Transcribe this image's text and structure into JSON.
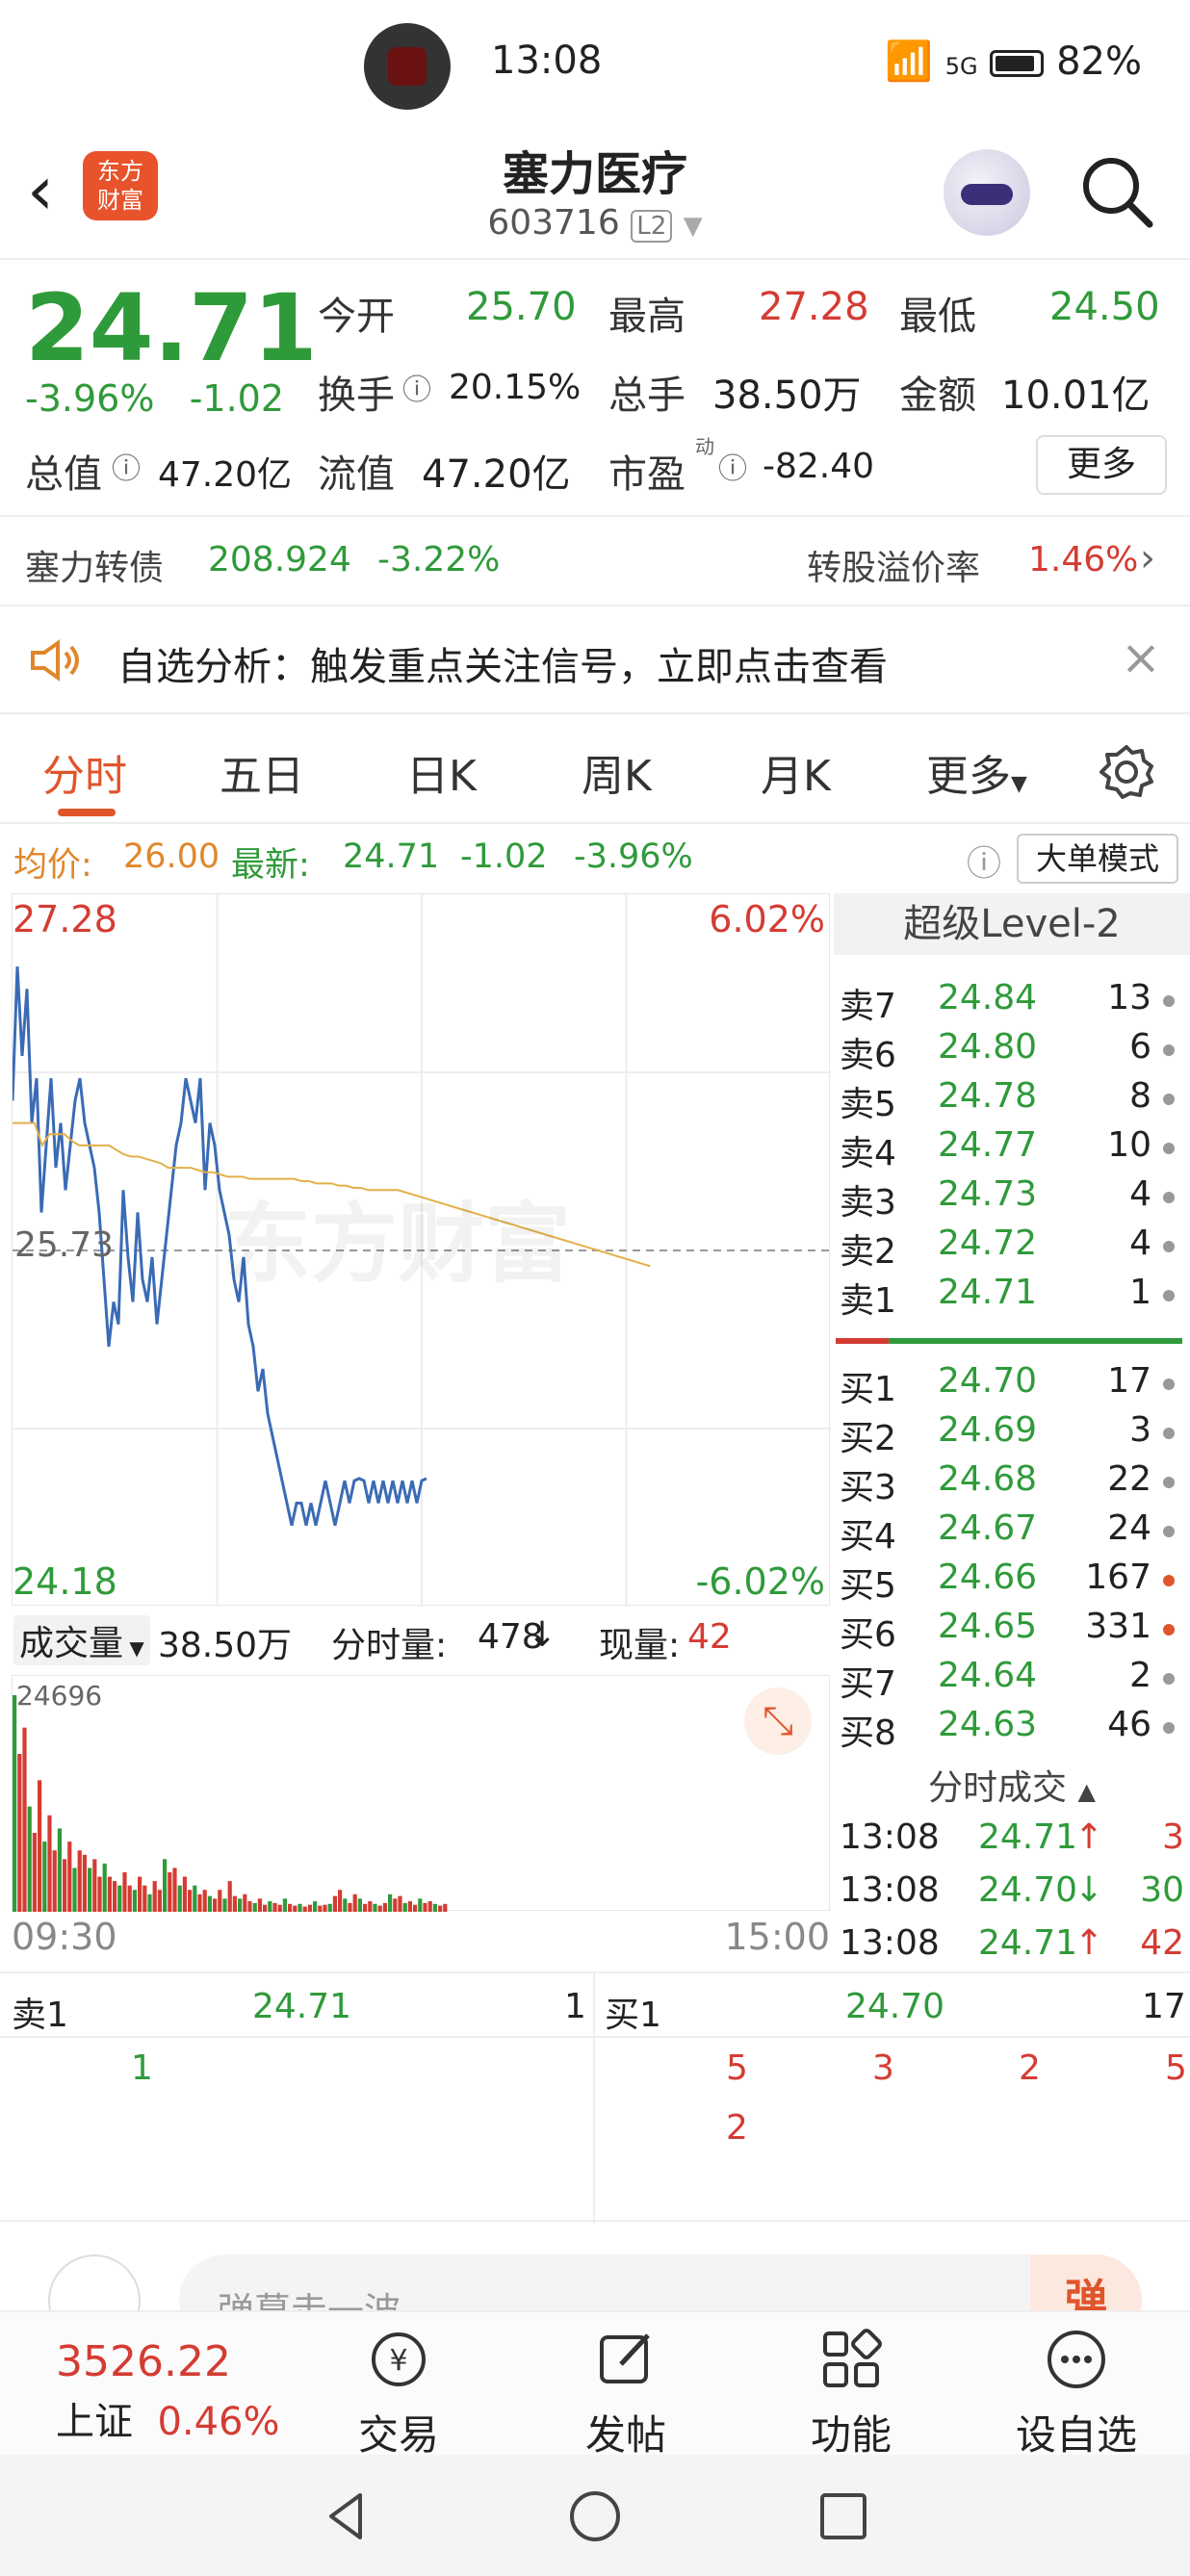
{
  "status_bar": {
    "time": "13:08",
    "network": "5G",
    "battery": "82%"
  },
  "header": {
    "logo_text": "东方财富",
    "title": "塞力医疗",
    "code": "603716",
    "level_badge": "L2"
  },
  "quote": {
    "price": "24.71",
    "change_pct": "-3.96%",
    "change": "-1.02",
    "open_label": "今开",
    "open": "25.70",
    "high_label": "最高",
    "high": "27.28",
    "low_label": "最低",
    "low": "24.50",
    "turnover_label": "换手",
    "turnover": "20.15%",
    "volume_label": "总手",
    "volume": "38.50万",
    "amount_label": "金额",
    "amount": "10.01亿",
    "mktcap_label": "总值",
    "mktcap": "47.20亿",
    "float_label": "流值",
    "float": "47.20亿",
    "pe_label": "市盈",
    "pe_sup": "动",
    "pe": "-82.40",
    "more_label": "更多"
  },
  "bond": {
    "name": "塞力转债",
    "price": "208.924",
    "change": "-3.22%",
    "premium_label": "转股溢价率",
    "premium": "1.46%"
  },
  "notice": {
    "text": "自选分析：触发重点关注信号，立即点击查看"
  },
  "tabs": [
    "分时",
    "五日",
    "日K",
    "周K",
    "月K",
    "更多"
  ],
  "avg_row": {
    "avg_label": "均价:",
    "avg": "26.00",
    "latest_label": "最新:",
    "latest": "24.71",
    "chg": "-1.02",
    "pct": "-3.96%",
    "mode_button": "大单模式"
  },
  "chart": {
    "top_price": "27.28",
    "top_pct": "6.02%",
    "mid_price": "25.73",
    "bottom_price": "24.18",
    "bottom_pct": "-6.02%",
    "watermark": "东方财富",
    "start_time": "09:30",
    "end_time": "15:00",
    "vol_axis_max": "24696"
  },
  "volume_bar": {
    "selector": "成交量",
    "total": "38.50万",
    "tick_label": "分时量:",
    "tick_value": "478",
    "now_label": "现量:",
    "now_value": "42"
  },
  "chart_data": {
    "type": "line",
    "x": [
      0,
      2,
      4,
      6,
      8,
      10,
      12,
      14,
      16,
      18,
      20,
      22,
      24,
      26,
      28,
      30,
      32,
      34,
      36,
      38,
      40,
      42,
      44,
      46,
      48,
      50,
      52,
      54,
      56,
      58,
      60,
      62,
      64,
      66,
      68,
      70,
      72,
      74,
      76,
      78,
      80,
      82,
      84,
      86,
      88,
      90,
      92,
      94,
      96,
      98,
      100,
      102,
      104,
      106,
      108,
      110,
      112,
      114,
      116,
      118,
      120,
      122,
      124,
      126,
      128,
      130,
      132,
      134,
      136,
      138,
      140,
      142,
      144,
      146,
      148,
      150,
      152,
      154,
      156,
      158,
      160,
      162,
      164,
      166,
      168,
      170,
      172
    ],
    "series": [
      {
        "values": [
          26.4,
          27.0,
          26.6,
          26.9,
          26.3,
          26.5,
          25.9,
          26.2,
          26.5,
          26.1,
          26.3,
          26.0,
          26.2,
          26.4,
          26.5,
          26.3,
          26.2,
          26.1,
          25.9,
          25.6,
          25.3,
          25.5,
          25.4,
          26.0,
          25.7,
          25.5,
          25.9,
          25.6,
          25.5,
          25.7,
          25.4,
          25.6,
          25.8,
          26.0,
          26.2,
          26.3,
          26.5,
          26.4,
          26.3,
          26.5,
          26.0,
          26.3,
          26.2,
          26.0,
          25.9,
          25.8,
          25.6,
          25.5,
          25.7,
          25.4,
          25.3,
          25.1,
          25.2,
          25.0,
          24.9,
          24.8,
          24.7,
          24.6,
          24.5,
          24.6,
          24.6,
          24.5,
          24.6,
          24.5,
          24.6,
          24.7,
          24.6,
          24.5,
          24.6,
          24.7,
          24.6,
          24.7,
          24.71,
          24.7,
          24.6,
          24.7,
          24.6,
          24.7,
          24.6,
          24.7,
          24.6,
          24.7,
          24.6,
          24.7,
          24.6,
          24.7,
          24.71
        ]
      },
      {
        "values": [
          26.3,
          26.3,
          26.3,
          26.3,
          26.2,
          26.25,
          26.25,
          26.25,
          26.22,
          26.2,
          26.2,
          26.2,
          26.2,
          26.2,
          26.18,
          26.16,
          26.15,
          26.15,
          26.14,
          26.13,
          26.12,
          26.1,
          26.1,
          26.1,
          26.1,
          26.09,
          26.08,
          26.08,
          26.07,
          26.06,
          26.06,
          26.06,
          26.05,
          26.05,
          26.05,
          26.05,
          26.05,
          26.05,
          26.05,
          26.04,
          26.04,
          26.03,
          26.03,
          26.03,
          26.02,
          26.02,
          26.01,
          26.01,
          26.0,
          26.0,
          26.0,
          26.0,
          26.0,
          25.99,
          25.98,
          25.97,
          25.96,
          25.95,
          25.94,
          25.93,
          25.92,
          25.91,
          25.9,
          25.89,
          25.88,
          25.87,
          25.86,
          25.85,
          25.84,
          25.83,
          25.82,
          25.81,
          25.8,
          25.79,
          25.78,
          25.77,
          25.76,
          25.75,
          25.74,
          25.73,
          25.72,
          25.71,
          25.7,
          25.69,
          25.68,
          25.67,
          25.66
        ]
      }
    ],
    "ylim": [
      24.18,
      27.28
    ],
    "volumes": [
      24696,
      18000,
      21000,
      12000,
      9000,
      15000,
      8000,
      11000,
      7000,
      9500,
      6000,
      8000,
      5000,
      7000,
      6500,
      5000,
      6000,
      4000,
      5500,
      4000,
      3500,
      3000,
      4500,
      3000,
      2500,
      4000,
      3000,
      2000,
      3500,
      2500,
      6000,
      4500,
      5000,
      3000,
      4000,
      2500,
      3000,
      2000,
      2500,
      1800,
      1500,
      2500,
      1500,
      3500,
      1800,
      1500,
      2000,
      1200,
      1000,
      1500,
      800,
      1200,
      1000,
      800,
      1500,
      900,
      700,
      900,
      600,
      800,
      1200,
      700,
      800,
      900,
      1800,
      2500,
      1500,
      1000,
      2000,
      1500,
      900,
      1200,
      900,
      700,
      1000,
      2000,
      1500,
      1800,
      1000,
      1200,
      800,
      1500,
      1000,
      1200,
      900,
      700,
      900
    ]
  },
  "level2": {
    "title": "超级Level-2",
    "asks": [
      {
        "label": "卖7",
        "price": "24.84",
        "qty": "13"
      },
      {
        "label": "卖6",
        "price": "24.80",
        "qty": "6"
      },
      {
        "label": "卖5",
        "price": "24.78",
        "qty": "8"
      },
      {
        "label": "卖4",
        "price": "24.77",
        "qty": "10"
      },
      {
        "label": "卖3",
        "price": "24.73",
        "qty": "4"
      },
      {
        "label": "卖2",
        "price": "24.72",
        "qty": "4"
      },
      {
        "label": "卖1",
        "price": "24.71",
        "qty": "1"
      }
    ],
    "bids": [
      {
        "label": "买1",
        "price": "24.70",
        "qty": "17"
      },
      {
        "label": "买2",
        "price": "24.69",
        "qty": "3"
      },
      {
        "label": "买3",
        "price": "24.68",
        "qty": "22"
      },
      {
        "label": "买4",
        "price": "24.67",
        "qty": "24"
      },
      {
        "label": "买5",
        "price": "24.66",
        "qty": "167"
      },
      {
        "label": "买6",
        "price": "24.65",
        "qty": "331"
      },
      {
        "label": "买7",
        "price": "24.64",
        "qty": "2"
      },
      {
        "label": "买8",
        "price": "24.63",
        "qty": "46"
      }
    ],
    "trade_head": "分时成交",
    "trades": [
      {
        "time": "13:08",
        "price": "24.71",
        "dir": "↑",
        "qty": "3"
      },
      {
        "time": "13:08",
        "price": "24.70",
        "dir": "↓",
        "qty": "30"
      },
      {
        "time": "13:08",
        "price": "24.71",
        "dir": "↑",
        "qty": "42"
      }
    ]
  },
  "book": {
    "ask1_label": "卖1",
    "ask1_price": "24.71",
    "ask1_qty": "1",
    "bid1_label": "买1",
    "bid1_price": "24.70",
    "bid1_qty": "17",
    "ask_orders": [
      "1"
    ],
    "bid_orders": [
      "5",
      "3",
      "2",
      "5",
      "2"
    ]
  },
  "comment": {
    "placeholder": "弹幕走一波",
    "button": "弹"
  },
  "bottom_nav": {
    "index_value": "3526.22",
    "index_name": "上证",
    "index_pct": "0.46%",
    "items": [
      "交易",
      "发帖",
      "功能",
      "设自选"
    ]
  }
}
